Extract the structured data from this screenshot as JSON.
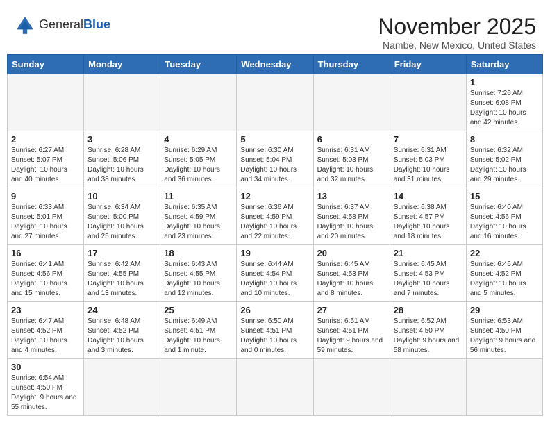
{
  "header": {
    "logo_general": "General",
    "logo_blue": "Blue",
    "month_title": "November 2025",
    "location": "Nambe, New Mexico, United States"
  },
  "days_of_week": [
    "Sunday",
    "Monday",
    "Tuesday",
    "Wednesday",
    "Thursday",
    "Friday",
    "Saturday"
  ],
  "weeks": [
    [
      {
        "day": "",
        "info": ""
      },
      {
        "day": "",
        "info": ""
      },
      {
        "day": "",
        "info": ""
      },
      {
        "day": "",
        "info": ""
      },
      {
        "day": "",
        "info": ""
      },
      {
        "day": "",
        "info": ""
      },
      {
        "day": "1",
        "info": "Sunrise: 7:26 AM\nSunset: 6:08 PM\nDaylight: 10 hours and 42 minutes."
      }
    ],
    [
      {
        "day": "2",
        "info": "Sunrise: 6:27 AM\nSunset: 5:07 PM\nDaylight: 10 hours and 40 minutes."
      },
      {
        "day": "3",
        "info": "Sunrise: 6:28 AM\nSunset: 5:06 PM\nDaylight: 10 hours and 38 minutes."
      },
      {
        "day": "4",
        "info": "Sunrise: 6:29 AM\nSunset: 5:05 PM\nDaylight: 10 hours and 36 minutes."
      },
      {
        "day": "5",
        "info": "Sunrise: 6:30 AM\nSunset: 5:04 PM\nDaylight: 10 hours and 34 minutes."
      },
      {
        "day": "6",
        "info": "Sunrise: 6:31 AM\nSunset: 5:03 PM\nDaylight: 10 hours and 32 minutes."
      },
      {
        "day": "7",
        "info": "Sunrise: 6:31 AM\nSunset: 5:03 PM\nDaylight: 10 hours and 31 minutes."
      },
      {
        "day": "8",
        "info": "Sunrise: 6:32 AM\nSunset: 5:02 PM\nDaylight: 10 hours and 29 minutes."
      }
    ],
    [
      {
        "day": "9",
        "info": "Sunrise: 6:33 AM\nSunset: 5:01 PM\nDaylight: 10 hours and 27 minutes."
      },
      {
        "day": "10",
        "info": "Sunrise: 6:34 AM\nSunset: 5:00 PM\nDaylight: 10 hours and 25 minutes."
      },
      {
        "day": "11",
        "info": "Sunrise: 6:35 AM\nSunset: 4:59 PM\nDaylight: 10 hours and 23 minutes."
      },
      {
        "day": "12",
        "info": "Sunrise: 6:36 AM\nSunset: 4:59 PM\nDaylight: 10 hours and 22 minutes."
      },
      {
        "day": "13",
        "info": "Sunrise: 6:37 AM\nSunset: 4:58 PM\nDaylight: 10 hours and 20 minutes."
      },
      {
        "day": "14",
        "info": "Sunrise: 6:38 AM\nSunset: 4:57 PM\nDaylight: 10 hours and 18 minutes."
      },
      {
        "day": "15",
        "info": "Sunrise: 6:40 AM\nSunset: 4:56 PM\nDaylight: 10 hours and 16 minutes."
      }
    ],
    [
      {
        "day": "16",
        "info": "Sunrise: 6:41 AM\nSunset: 4:56 PM\nDaylight: 10 hours and 15 minutes."
      },
      {
        "day": "17",
        "info": "Sunrise: 6:42 AM\nSunset: 4:55 PM\nDaylight: 10 hours and 13 minutes."
      },
      {
        "day": "18",
        "info": "Sunrise: 6:43 AM\nSunset: 4:55 PM\nDaylight: 10 hours and 12 minutes."
      },
      {
        "day": "19",
        "info": "Sunrise: 6:44 AM\nSunset: 4:54 PM\nDaylight: 10 hours and 10 minutes."
      },
      {
        "day": "20",
        "info": "Sunrise: 6:45 AM\nSunset: 4:53 PM\nDaylight: 10 hours and 8 minutes."
      },
      {
        "day": "21",
        "info": "Sunrise: 6:45 AM\nSunset: 4:53 PM\nDaylight: 10 hours and 7 minutes."
      },
      {
        "day": "22",
        "info": "Sunrise: 6:46 AM\nSunset: 4:52 PM\nDaylight: 10 hours and 5 minutes."
      }
    ],
    [
      {
        "day": "23",
        "info": "Sunrise: 6:47 AM\nSunset: 4:52 PM\nDaylight: 10 hours and 4 minutes."
      },
      {
        "day": "24",
        "info": "Sunrise: 6:48 AM\nSunset: 4:52 PM\nDaylight: 10 hours and 3 minutes."
      },
      {
        "day": "25",
        "info": "Sunrise: 6:49 AM\nSunset: 4:51 PM\nDaylight: 10 hours and 1 minute."
      },
      {
        "day": "26",
        "info": "Sunrise: 6:50 AM\nSunset: 4:51 PM\nDaylight: 10 hours and 0 minutes."
      },
      {
        "day": "27",
        "info": "Sunrise: 6:51 AM\nSunset: 4:51 PM\nDaylight: 9 hours and 59 minutes."
      },
      {
        "day": "28",
        "info": "Sunrise: 6:52 AM\nSunset: 4:50 PM\nDaylight: 9 hours and 58 minutes."
      },
      {
        "day": "29",
        "info": "Sunrise: 6:53 AM\nSunset: 4:50 PM\nDaylight: 9 hours and 56 minutes."
      }
    ],
    [
      {
        "day": "30",
        "info": "Sunrise: 6:54 AM\nSunset: 4:50 PM\nDaylight: 9 hours and 55 minutes."
      },
      {
        "day": "",
        "info": ""
      },
      {
        "day": "",
        "info": ""
      },
      {
        "day": "",
        "info": ""
      },
      {
        "day": "",
        "info": ""
      },
      {
        "day": "",
        "info": ""
      },
      {
        "day": "",
        "info": ""
      }
    ]
  ]
}
